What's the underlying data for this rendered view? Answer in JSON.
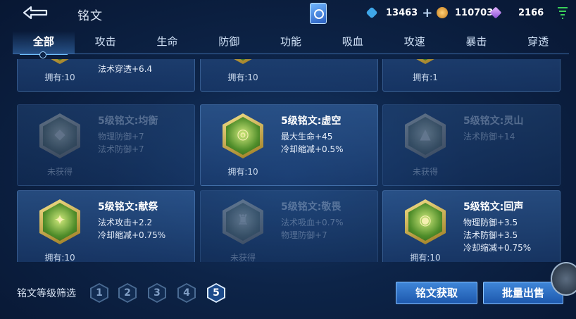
{
  "header": {
    "title": "铭文",
    "currencies": [
      {
        "icon": "diamond-coupon-icon",
        "value": "13463"
      },
      {
        "icon": "gold-coin-icon",
        "value": "110703"
      },
      {
        "icon": "gem-icon",
        "value": "2166"
      }
    ]
  },
  "tabs": [
    "全部",
    "攻击",
    "生命",
    "防御",
    "功能",
    "吸血",
    "攻速",
    "暴击",
    "穿透"
  ],
  "cards": [
    {
      "name": "",
      "stats": [
        "法术穿透+6.4"
      ],
      "owned": "拥有:10",
      "dim": false
    },
    {
      "name": "",
      "stats": [],
      "owned": "拥有:10",
      "dim": false
    },
    {
      "name": "",
      "stats": [],
      "owned": "拥有:1",
      "dim": false
    },
    {
      "name": "5级铭文:均衡",
      "stats": [
        "物理防御+7",
        "法术防御+7"
      ],
      "owned": "未获得",
      "dim": true
    },
    {
      "name": "5级铭文:虚空",
      "stats": [
        "最大生命+45",
        "冷却缩减+0.5%"
      ],
      "owned": "拥有:10",
      "dim": false
    },
    {
      "name": "5级铭文:灵山",
      "stats": [
        "法术防御+14"
      ],
      "owned": "未获得",
      "dim": true
    },
    {
      "name": "5级铭文:献祭",
      "stats": [
        "法术攻击+2.2",
        "冷却缩减+0.75%"
      ],
      "owned": "拥有:10",
      "dim": false
    },
    {
      "name": "5级铭文:敬畏",
      "stats": [
        "法术吸血+0.7%",
        "物理防御+7"
      ],
      "owned": "未获得",
      "dim": true
    },
    {
      "name": "5级铭文:回声",
      "stats": [
        "物理防御+3.5",
        "法术防御+3.5",
        "冷却缩减+0.75%"
      ],
      "owned": "拥有:10",
      "dim": false
    }
  ],
  "footer": {
    "filter_label": "铭文等级筛选",
    "levels": [
      "1",
      "2",
      "3",
      "4",
      "5"
    ],
    "active_level": "5",
    "acquire_label": "铭文获取",
    "sell_label": "批量出售"
  }
}
